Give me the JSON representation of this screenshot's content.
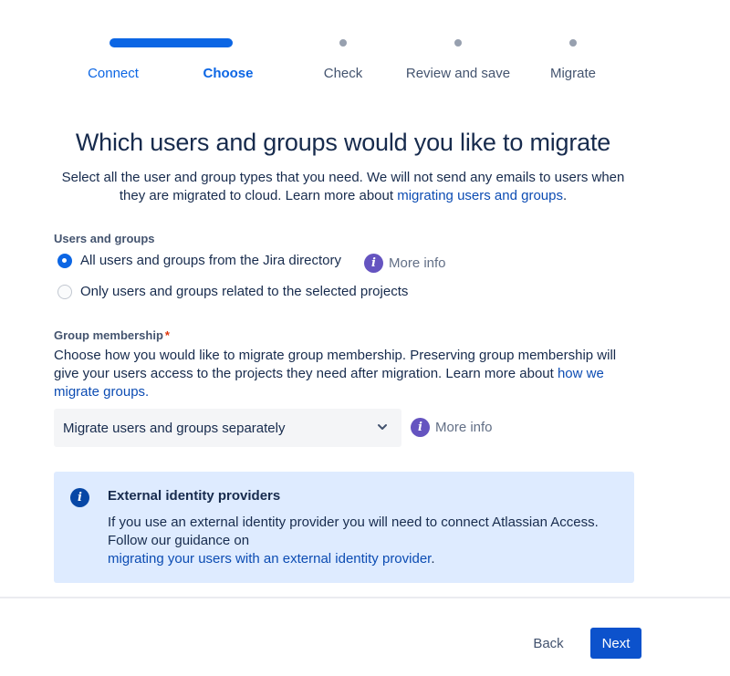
{
  "steps": [
    {
      "label": "Connect",
      "state": "done"
    },
    {
      "label": "Choose",
      "state": "current"
    },
    {
      "label": "Check",
      "state": "todo"
    },
    {
      "label": "Review and save",
      "state": "todo"
    },
    {
      "label": "Migrate",
      "state": "todo"
    }
  ],
  "heading": {
    "title": "Which users and groups would you like to migrate",
    "subtitle_text": "Select all the user and group types that you need. We will not send any emails to users when they are migrated to cloud. Learn more about ",
    "subtitle_link": "migrating users and groups",
    "subtitle_end": "."
  },
  "users_groups": {
    "label": "Users and groups",
    "options": [
      {
        "label": "All users and groups from the Jira directory",
        "checked": true
      },
      {
        "label": "Only users and groups related to the selected projects",
        "checked": false
      }
    ],
    "more_info": "More info"
  },
  "group_membership": {
    "label": "Group membership",
    "required_mark": "*",
    "description": "Choose how you would like to migrate group membership. Preserving group membership will give your users access to the projects they need after migration. Learn more about ",
    "link": "how we migrate groups.",
    "select_value": "Migrate users and groups separately",
    "more_info": "More info"
  },
  "panel": {
    "title": "External identity providers",
    "body": "If you use an external identity provider you will need to connect Atlassian Access. Follow our guidance on ",
    "link": "migrating your users with an external identity provider",
    "end": "."
  },
  "footer": {
    "back_label": "Back",
    "next_label": "Next"
  },
  "colors": {
    "primary": "#0c66e4",
    "info_purple": "#6554c0",
    "panel_bg": "#deebff"
  }
}
